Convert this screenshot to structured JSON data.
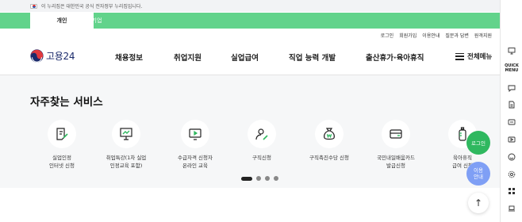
{
  "gov_banner": {
    "text": "이 누리집은 대한민국 공식 전자정부 누리집입니다."
  },
  "user_tabs": [
    {
      "label": "개인",
      "active": true
    },
    {
      "label": "기업",
      "active": false
    }
  ],
  "util_links": [
    "로그인",
    "회원가입",
    "이용안내",
    "질문과 답변",
    "원격지원"
  ],
  "logo": {
    "text": "고용24"
  },
  "nav": [
    "채용정보",
    "취업지원",
    "실업급여",
    "직업 능력 개발",
    "출산휴가·육아휴직"
  ],
  "all_menu_label": "전체메뉴",
  "favorites": {
    "title": "자주찾는 서비스",
    "services": [
      {
        "label": "실업인정\n인터넷 신청",
        "icon": "document-pen-icon"
      },
      {
        "label": "취업특강(1차 실업\n인정교육 포함)",
        "icon": "presentation-board-icon"
      },
      {
        "label": "수급자격 신청자\n온라인 교육",
        "icon": "video-monitor-icon"
      },
      {
        "label": "구직신청",
        "icon": "person-pen-icon"
      },
      {
        "label": "구직촉진수당 신청",
        "icon": "money-bag-icon"
      },
      {
        "label": "국민내일배움카드\n발급신청",
        "icon": "card-icon"
      },
      {
        "label": "육아휴직\n급여 신청",
        "icon": "baby-bottle-icon"
      }
    ],
    "pager": {
      "pages": 4,
      "current": 1
    }
  },
  "float_buttons": {
    "login": "로그인",
    "guide": "이용\n안내",
    "top": "↑"
  },
  "quick_menu": {
    "title": "QUICK\nMENU",
    "icons": [
      "monitor-icon",
      "chat-bubble-icon",
      "document-icon",
      "tablet-icon",
      "video-icon",
      "smile-icon",
      "settings-icon",
      "grid-icon",
      "laptop-icon"
    ]
  },
  "colors": {
    "brand_green": "#62d38b",
    "login_green": "#2fb85f",
    "guide_blue": "#7f9ff5",
    "logo_navy": "#1b2a6b"
  }
}
